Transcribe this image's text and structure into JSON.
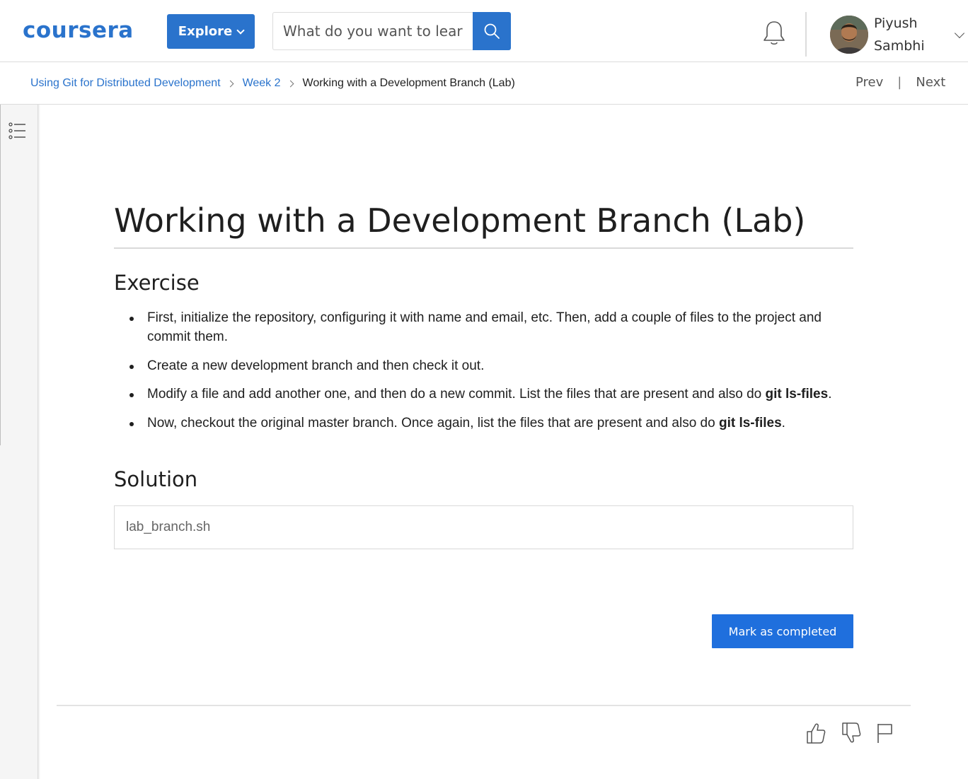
{
  "header": {
    "logo_text": "coursera",
    "explore_label": "Explore",
    "search_placeholder": "What do you want to learn?",
    "user_first_name": "Piyush",
    "user_last_name": "Sambhi",
    "brand_color": "#2a73cc"
  },
  "breadcrumb": {
    "items": [
      {
        "label": "Using Git for Distributed Development"
      },
      {
        "label": "Week 2"
      },
      {
        "label": "Working with a Development Branch (Lab)"
      }
    ],
    "prev_label": "Prev",
    "separator": "|",
    "next_label": "Next"
  },
  "sidebar": {
    "toc_icon": "list-icon"
  },
  "main": {
    "title": "Working with a Development Branch (Lab)",
    "exercise_heading": "Exercise",
    "exercise_items": [
      {
        "text_before": "First, initialize the repository, configuring it with name and email, etc. Then, add a couple of files to the project and commit them.",
        "bold": "",
        "text_after": ""
      },
      {
        "text_before": "Create a new development branch and then check it out.",
        "bold": "",
        "text_after": ""
      },
      {
        "text_before": "Modify a file and add another one, and then do a new commit. List the files that are present and also do ",
        "bold": "git ls-files",
        "text_after": "."
      },
      {
        "text_before": "Now, checkout the original master branch. Once again, list the files that are present and also do ",
        "bold": "git ls-files",
        "text_after": "."
      }
    ],
    "solution_heading": "Solution",
    "solution_file": "lab_branch.sh",
    "mark_completed_label": "Mark as completed"
  },
  "feedback": {
    "like_icon": "thumbs-up-icon",
    "dislike_icon": "thumbs-down-icon",
    "flag_icon": "flag-icon"
  }
}
